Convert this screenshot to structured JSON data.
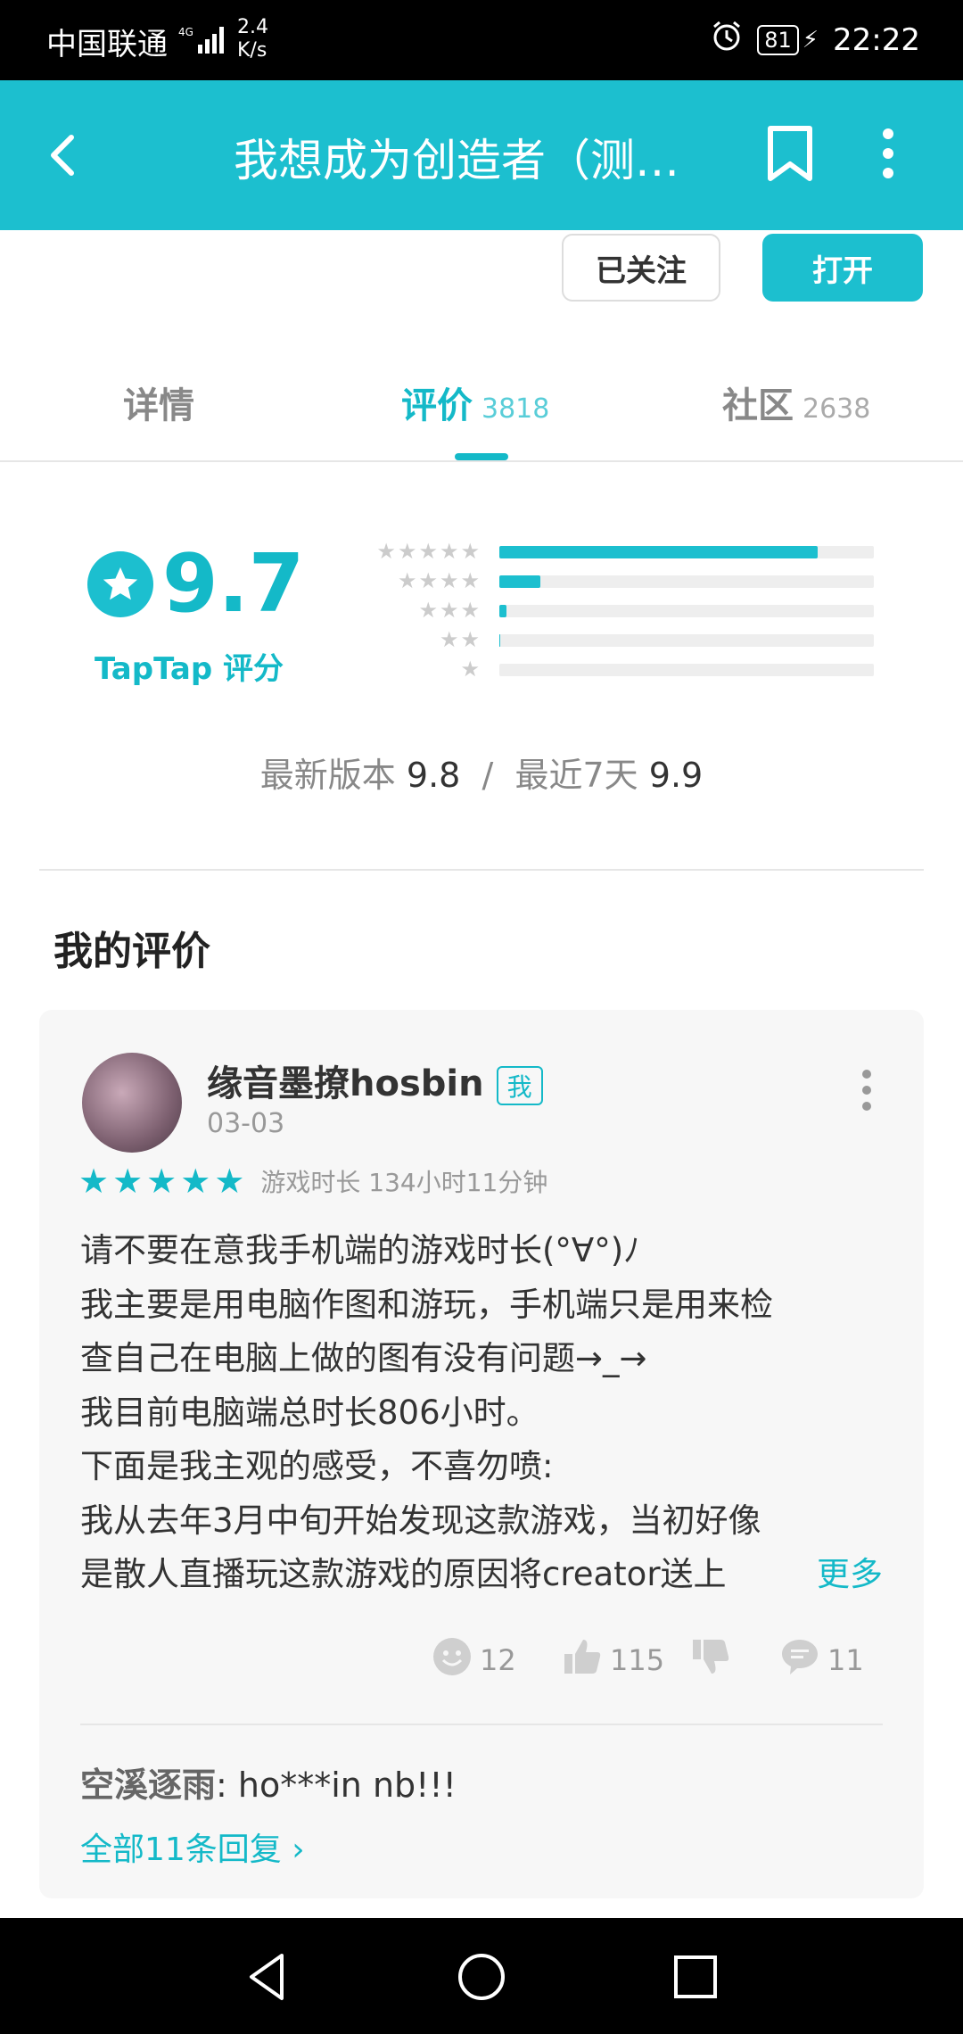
{
  "status_bar": {
    "carrier": "中国联通",
    "net_speed_value": "2.4",
    "net_speed_unit": "K/s",
    "battery": "81",
    "time": "22:22"
  },
  "app_bar": {
    "title": "我想成为创造者（测…",
    "icons": [
      "back-arrow-icon",
      "bookmark-icon",
      "more-vertical-icon"
    ]
  },
  "actions": {
    "follow_label": "已关注",
    "open_label": "打开"
  },
  "tabs": [
    {
      "label": "详情",
      "count": "",
      "active": false
    },
    {
      "label": "评价",
      "count": "3818",
      "active": true
    },
    {
      "label": "社区",
      "count": "2638",
      "active": false
    }
  ],
  "rating_summary": {
    "score": "9.7",
    "label": "TapTap 评分",
    "distribution": [
      {
        "stars": "★★★★★",
        "fraction": 0.85
      },
      {
        "stars": "★★★★",
        "fraction": 0.11
      },
      {
        "stars": "★★★",
        "fraction": 0.02
      },
      {
        "stars": "★★",
        "fraction": 0.003
      },
      {
        "stars": "★",
        "fraction": 0.0
      }
    ],
    "latest_version_label": "最新版本",
    "latest_version_score": "9.8",
    "separator": "/",
    "recent_label": "最近7天",
    "recent_score": "9.9"
  },
  "my_review": {
    "section_title": "我的评价",
    "username": "缘音墨撩hosbin",
    "me_badge": "我",
    "date": "03-03",
    "stars": 5,
    "playtime": "游戏时长 134小时11分钟",
    "lines": [
      "请不要在意我手机端的游戏时长(°∀°)ﾉ",
      "我主要是用电脑作图和游玩，手机端只是用来检",
      "查自己在电脑上做的图有没有问题→_→",
      "我目前电脑端总时长806小时。",
      "下面是我主观的感受，不喜勿喷:",
      "我从去年3月中旬开始发现这款游戏，当初好像",
      "是散人直播玩这款游戏的原因将creator送上"
    ],
    "more_label": "更多",
    "stats": {
      "funny": "12",
      "like": "115",
      "dislike": "",
      "comments": "11"
    },
    "reply_user": "空溪逐雨",
    "reply_text": ": ho***in nb!!!",
    "all_replies": "全部11条回复 ›"
  },
  "nav_bar": {
    "icons": [
      "nav-back-icon",
      "nav-home-icon",
      "nav-recents-icon"
    ]
  },
  "colors": {
    "accent": "#1cbfcf",
    "accent_text": "#14b9c8"
  }
}
